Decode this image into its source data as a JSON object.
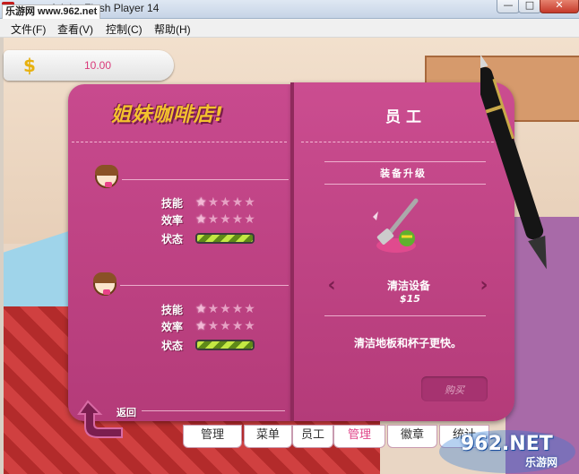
{
  "window": {
    "title": "Adobe Flash Player 14",
    "site_badge": "乐游网 www.962.net",
    "minimize": "—",
    "maximize": "□",
    "close": "✕"
  },
  "menu": {
    "file": "文件(F)",
    "view": "查看(V)",
    "control": "控制(C)",
    "help": "帮助(H)"
  },
  "hud": {
    "money": "10.00",
    "currency_icon": "dollar-coin-icon"
  },
  "book": {
    "logo": "姐妹咖啡店!",
    "staff": [
      {
        "skill_label": "技能",
        "efficiency_label": "效率",
        "status_label": "状态",
        "skill_stars": 1,
        "efficiency_stars": 1,
        "max_stars": 5,
        "status_level": 1.0
      },
      {
        "skill_label": "技能",
        "efficiency_label": "效率",
        "status_label": "状态",
        "skill_stars": 1,
        "efficiency_stars": 1,
        "max_stars": 5,
        "status_level": 1.0
      }
    ],
    "back_label": "返回",
    "right_title": "员工",
    "upgrade_title": "装备升级",
    "item_name": "清洁设备",
    "item_price": "$15",
    "description": "清洁地板和杯子更快。",
    "buy_label": "购买"
  },
  "tabs": [
    "管理",
    "菜单",
    "员工",
    "管理",
    "徽章",
    "统计"
  ],
  "active_tab_index": 3,
  "watermark": {
    "main": "962.NET",
    "sub": "乐游网"
  },
  "colors": {
    "book_pink": "#c84a8e",
    "accent_pink": "#e0468a",
    "status_green": "#c3e843"
  }
}
